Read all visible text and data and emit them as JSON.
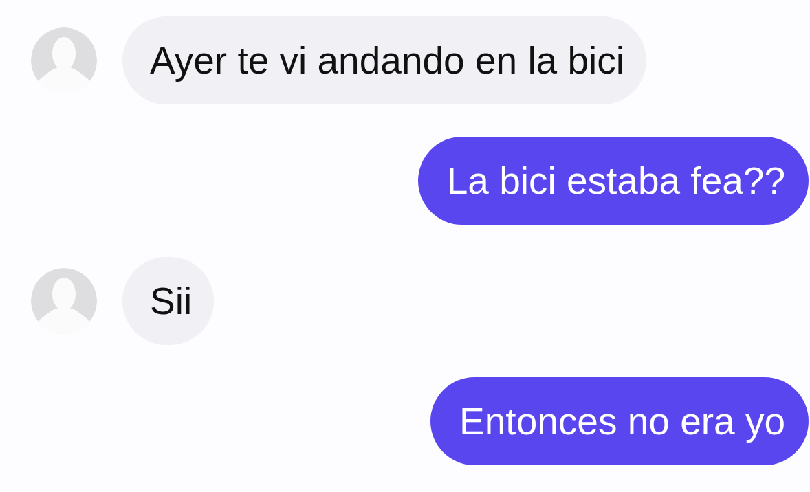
{
  "messages": [
    {
      "kind": "incoming",
      "text": "Ayer te vi andando en la bici"
    },
    {
      "kind": "outgoing",
      "text": "La bici estaba fea??"
    },
    {
      "kind": "incoming",
      "text": "Sii"
    },
    {
      "kind": "outgoing",
      "text": "Entonces no era yo"
    }
  ]
}
